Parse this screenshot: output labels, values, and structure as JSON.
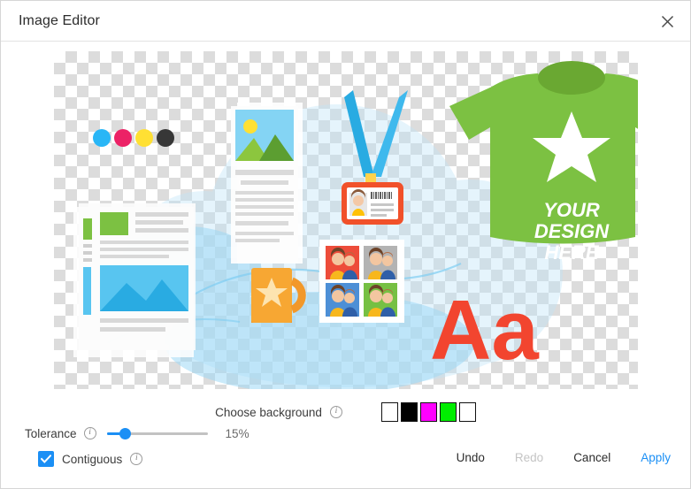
{
  "window": {
    "title": "Image Editor",
    "close_icon": "close-icon"
  },
  "canvas": {
    "alt": "transparent-checkerboard-artwork",
    "artwork_elements": [
      "cmyk-dots",
      "photo-document",
      "text-document",
      "orange-mug-with-star",
      "id-badge-with-lanyard",
      "passport-photo-sheet",
      "green-tshirt",
      "aa-letters"
    ],
    "tshirt_text_line1": "YOUR",
    "tshirt_text_line2": "DESIGN",
    "tshirt_text_line3": "HERE",
    "typography_sample": "Aa"
  },
  "background_chooser": {
    "label": "Choose background",
    "info_icon": "info-icon",
    "info_glyph": "i",
    "swatches": [
      {
        "name": "white",
        "color": "#ffffff"
      },
      {
        "name": "black",
        "color": "#000000"
      },
      {
        "name": "magenta",
        "color": "#ff00ff"
      },
      {
        "name": "green",
        "color": "#00ee00"
      },
      {
        "name": "white",
        "color": "#ffffff"
      }
    ]
  },
  "tolerance": {
    "label": "Tolerance",
    "info_icon": "info-icon",
    "info_glyph": "i",
    "value_text": "15%",
    "value": 15,
    "min": 0,
    "max": 100,
    "accent": "#1b8ff5"
  },
  "contiguous": {
    "label": "Contiguous",
    "checked": true,
    "info_icon": "info-icon",
    "info_glyph": "i"
  },
  "actions": {
    "undo": "Undo",
    "redo": "Redo",
    "redo_disabled": true,
    "cancel": "Cancel",
    "apply": "Apply",
    "apply_color": "#1b8ff5"
  }
}
